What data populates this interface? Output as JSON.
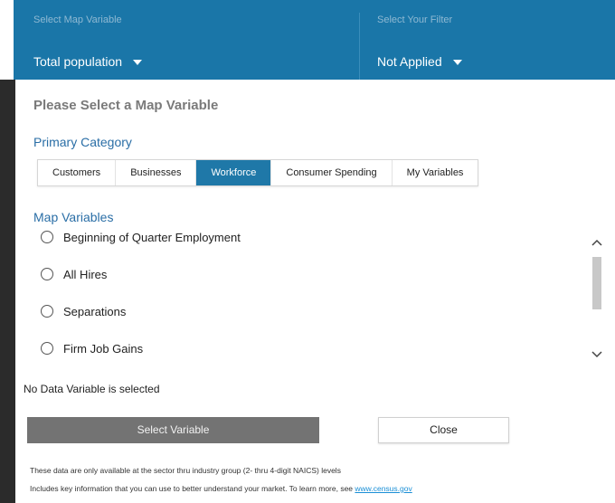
{
  "header": {
    "map_variable_label": "Select Map Variable",
    "map_variable_value": "Total population",
    "filter_label": "Select Your Filter",
    "filter_value": "Not Applied"
  },
  "dialog": {
    "title": "Please Select a Map Variable",
    "primary_category_title": "Primary Category",
    "tabs": [
      {
        "label": "Customers",
        "active": false
      },
      {
        "label": "Businesses",
        "active": false
      },
      {
        "label": "Workforce",
        "active": true
      },
      {
        "label": "Consumer Spending",
        "active": false
      },
      {
        "label": "My Variables",
        "active": false
      }
    ],
    "map_variables_title": "Map Variables",
    "variables": [
      {
        "label": "Beginning of Quarter Employment",
        "selected": false
      },
      {
        "label": "All Hires",
        "selected": false
      },
      {
        "label": "Separations",
        "selected": false
      },
      {
        "label": "Firm Job Gains",
        "selected": false
      }
    ],
    "status_text": "No Data Variable is selected",
    "select_button": "Select Variable",
    "close_button": "Close",
    "note_1": "These data are only available at the sector thru industry group (2- thru 4-digit NAICS) levels",
    "note_2_text": "Includes key information that you can use to better understand your market. To learn more, see ",
    "note_2_link": "www.census.gov"
  },
  "icons": {
    "dropdown_caret": "chevron-down-icon",
    "scroll_up": "chevron-up-icon",
    "scroll_down": "chevron-down-icon"
  },
  "colors": {
    "header_bg": "#1a76a8",
    "accent_blue": "#2a6ea6",
    "active_tab": "#1f78a8",
    "primary_button": "#737373",
    "link": "#1a8fd6"
  }
}
